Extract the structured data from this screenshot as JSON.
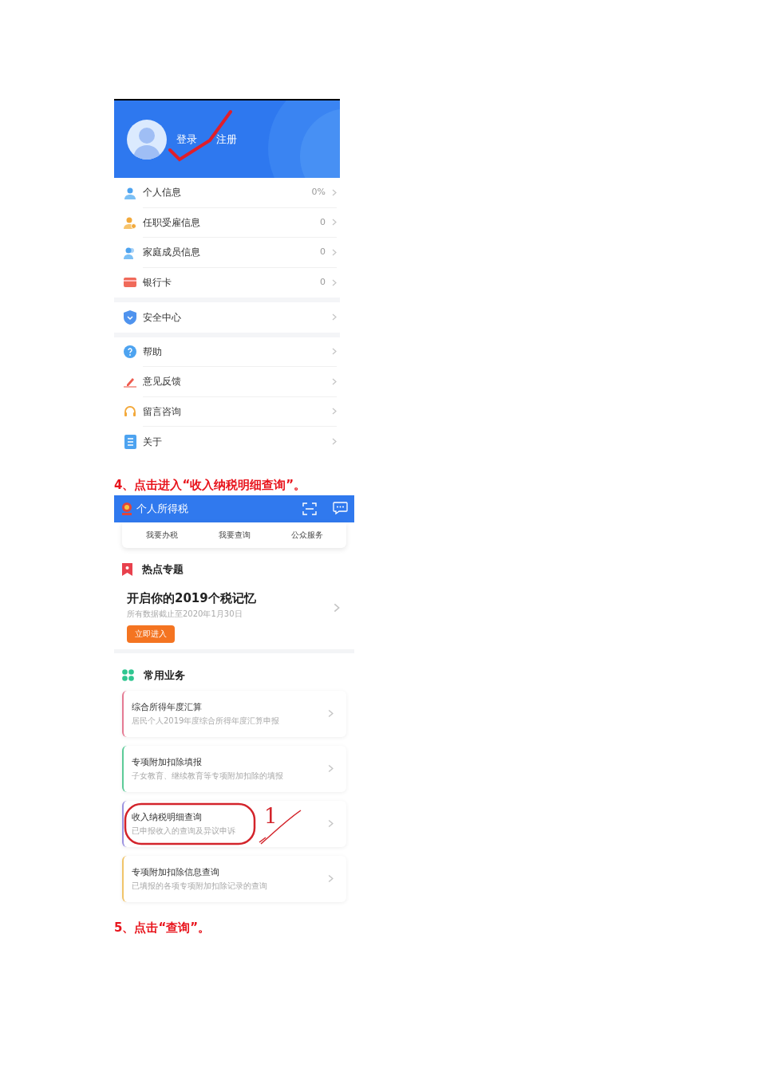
{
  "profile_screen": {
    "header": {
      "login_label": "登录",
      "register_label": "注册"
    },
    "menu_groups": [
      {
        "items": [
          {
            "kind": "person",
            "label": "个人信息",
            "value": "0%"
          },
          {
            "kind": "employment",
            "label": "任职受雇信息",
            "value": "0"
          },
          {
            "kind": "family",
            "label": "家庭成员信息",
            "value": "0"
          },
          {
            "kind": "card",
            "label": "银行卡",
            "value": "0"
          }
        ]
      },
      {
        "items": [
          {
            "kind": "shield",
            "label": "安全中心"
          }
        ]
      },
      {
        "items": [
          {
            "kind": "help",
            "label": "帮助"
          },
          {
            "kind": "pen",
            "label": "意见反馈"
          },
          {
            "kind": "headset",
            "label": "留言咨询"
          },
          {
            "kind": "doc",
            "label": "关于"
          }
        ]
      }
    ]
  },
  "step_4_caption": "4、点击进入“收入纳税明细查询”。",
  "tax_app_screen": {
    "app_title": "个人所得税",
    "quick_tabs": [
      "我要办税",
      "我要查询",
      "公众服务"
    ],
    "hot_topics": {
      "heading": "热点专题",
      "title": "开启你的2019个税记忆",
      "subtitle": "所有数据截止至2020年1月30日",
      "button": "立即进入"
    },
    "services": {
      "heading": "常用业务",
      "items": [
        {
          "title": "综合所得年度汇算",
          "subtitle": "居民个人2019年度综合所得年度汇算申报",
          "color": "#e57a93",
          "circled": false
        },
        {
          "title": "专项附加扣除填报",
          "subtitle": "子女教育、继续教育等专项附加扣除的填报",
          "color": "#5ccb98",
          "circled": false
        },
        {
          "title": "收入纳税明细查询",
          "subtitle": "已申报收入的查询及异议申诉",
          "color": "#9c93e0",
          "circled": true,
          "annotation": "1"
        },
        {
          "title": "专项附加扣除信息查询",
          "subtitle": "已填报的各项专项附加扣除记录的查询",
          "color": "#f0c46a",
          "circled": false
        }
      ]
    }
  },
  "step_5_caption": "5、点击“查询”。"
}
